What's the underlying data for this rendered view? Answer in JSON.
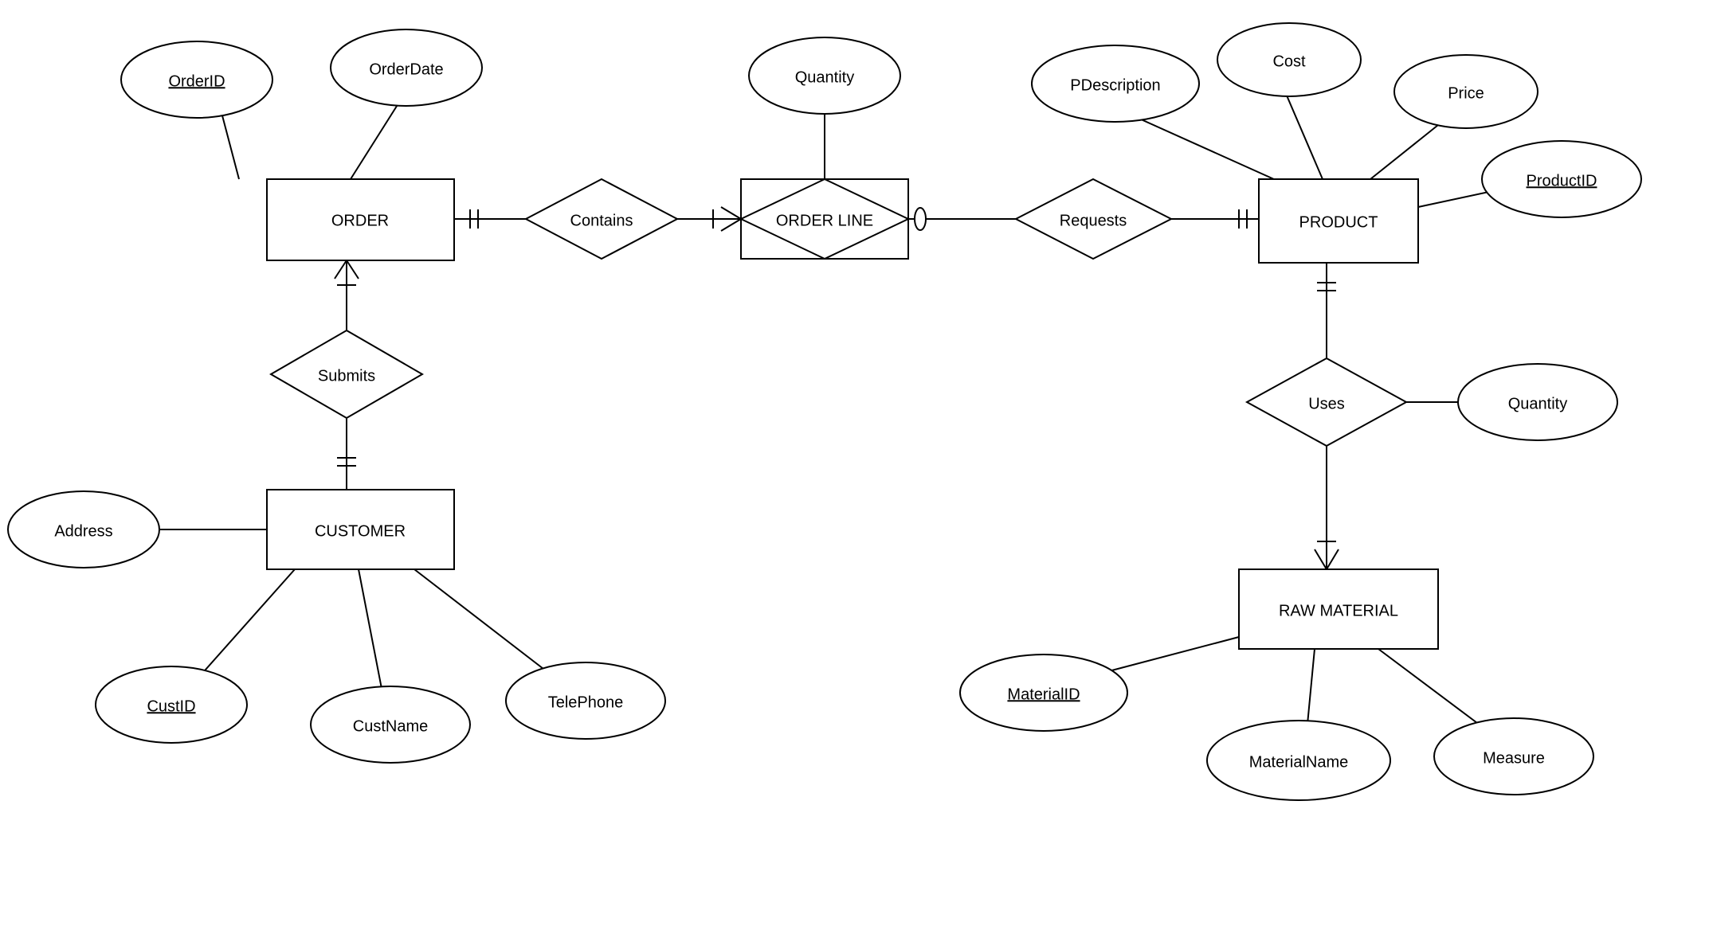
{
  "entities": {
    "order": "ORDER",
    "orderline": "ORDER LINE",
    "product": "PRODUCT",
    "customer": "CUSTOMER",
    "rawmaterial": "RAW MATERIAL"
  },
  "relationships": {
    "contains": "Contains",
    "requests": "Requests",
    "submits": "Submits",
    "uses": "Uses"
  },
  "attributes": {
    "orderid": "OrderID",
    "orderdate": "OrderDate",
    "ol_quantity": "Quantity",
    "pdescription": "PDescription",
    "cost": "Cost",
    "price": "Price",
    "productid": "ProductID",
    "address": "Address",
    "custid": "CustID",
    "custname": "CustName",
    "telephone": "TelePhone",
    "uses_quantity": "Quantity",
    "materialid": "MaterialID",
    "materialname": "MaterialName",
    "measure": "Measure"
  }
}
